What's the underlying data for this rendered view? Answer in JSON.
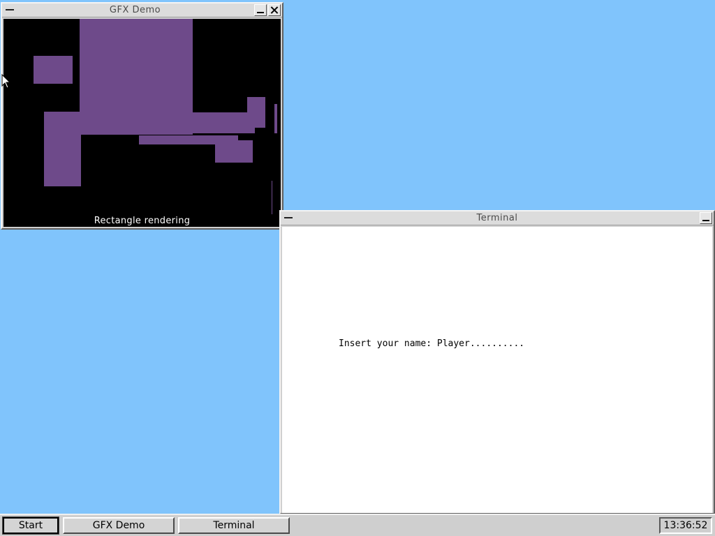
{
  "theme": {
    "desktop_color": "#80c4fc",
    "rect_color": "#6e4a8a",
    "canvas_bg": "#000000",
    "terminal_bg": "#ffffff"
  },
  "gfx_window": {
    "title": "GFX Demo",
    "caption": "Rectangle rendering",
    "icons": [
      "system-menu-icon",
      "minimize-icon",
      "close-icon"
    ]
  },
  "terminal_window": {
    "title": "Terminal",
    "prompt_line": "Insert your name: Player..........",
    "icons": [
      "system-menu-icon",
      "minimize-icon"
    ]
  },
  "taskbar": {
    "start_label": "Start",
    "tasks": [
      {
        "label": "GFX Demo"
      },
      {
        "label": "Terminal"
      }
    ],
    "clock": "13:36:52"
  },
  "cursor": {
    "icon": "mouse-pointer-icon"
  }
}
